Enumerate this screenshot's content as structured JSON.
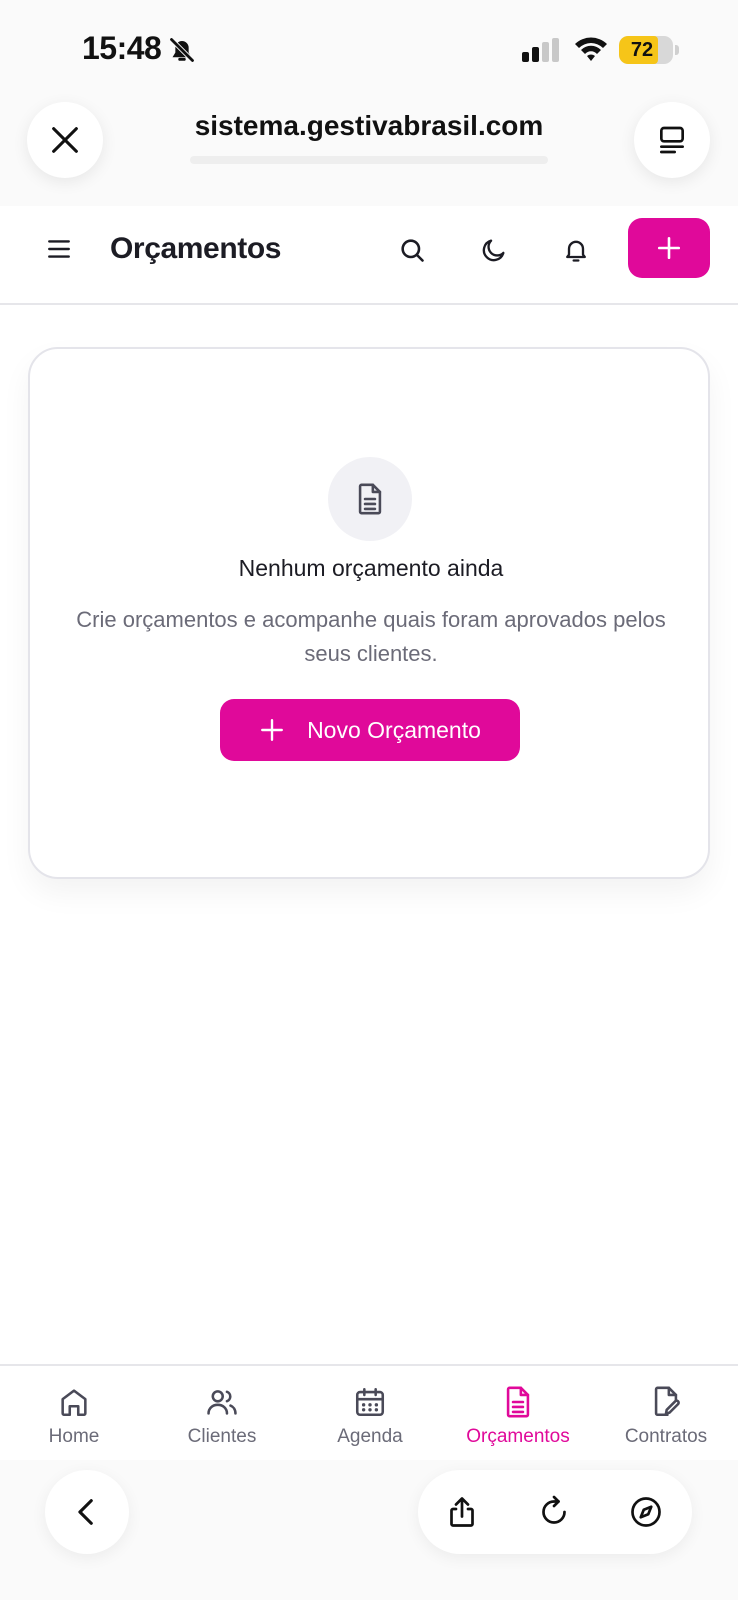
{
  "status_bar": {
    "time": "15:48",
    "battery": "72",
    "battery_level": 0.72,
    "icons": [
      "bell-slash-icon",
      "cellular-signal-icon",
      "wifi-icon",
      "battery-icon"
    ]
  },
  "browser": {
    "url": "sistema.gestivabrasil.com",
    "close_icon": "close-icon",
    "tabs_icon": "tabs-icon",
    "back_icon": "chevron-left-icon",
    "share_icon": "share-icon",
    "reload_icon": "reload-icon",
    "compass_icon": "compass-icon"
  },
  "header": {
    "title": "Orçamentos",
    "menu_icon": "hamburger-menu-icon",
    "search_icon": "search-icon",
    "theme_icon": "moon-icon",
    "notifications_icon": "bell-icon",
    "add_icon": "plus-icon"
  },
  "empty_state": {
    "icon": "document-icon",
    "title": "Nenhum orçamento ainda",
    "description": "Crie orçamentos e acompanhe quais foram aprovados pelos seus clientes.",
    "button_label": "Novo Orçamento"
  },
  "tabbar": {
    "items": [
      {
        "label": "Home",
        "icon": "home-icon",
        "active": false
      },
      {
        "label": "Clientes",
        "icon": "users-icon",
        "active": false
      },
      {
        "label": "Agenda",
        "icon": "calendar-icon",
        "active": false
      },
      {
        "label": "Orçamentos",
        "icon": "document-icon",
        "active": true
      },
      {
        "label": "Contratos",
        "icon": "file-signature-icon",
        "active": false
      }
    ]
  },
  "colors": {
    "accent": "#e0099a",
    "text_primary": "#1c1c24",
    "text_secondary": "#6b6b78",
    "battery": "#f6c518"
  }
}
